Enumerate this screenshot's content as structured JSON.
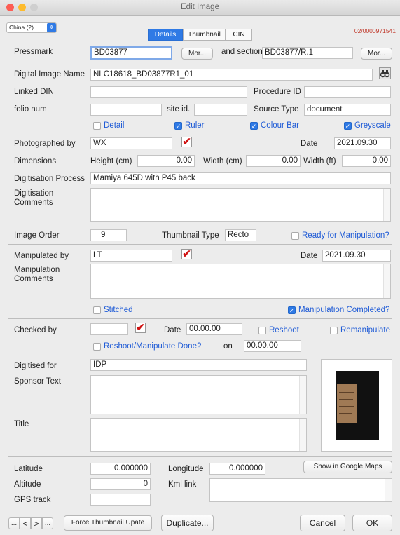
{
  "window": {
    "title": "Edit Image"
  },
  "top": {
    "collection_select": "China (2)",
    "record_id": "02/0000971541",
    "tabs": [
      {
        "label": "Details"
      },
      {
        "label": "Thumbnail"
      },
      {
        "label": "CIN"
      }
    ]
  },
  "fields": {
    "pressmark": {
      "label": "Pressmark",
      "value": "BD03877",
      "more_label": "Mor..."
    },
    "section": {
      "label": "and section",
      "value": "BD03877/R.1",
      "more_label": "Mor..."
    },
    "digital_image_name": {
      "label": "Digital Image Name",
      "value": "NLC18618_BD03877R1_01"
    },
    "linked_din": {
      "label": "Linked DIN",
      "value": ""
    },
    "procedure_id": {
      "label": "Procedure ID",
      "value": ""
    },
    "folio_num": {
      "label": "folio num",
      "value": ""
    },
    "site_id": {
      "label": "site id.",
      "value": ""
    },
    "source_type": {
      "label": "Source Type",
      "value": "document"
    },
    "checkboxes_row": {
      "detail": "Detail",
      "ruler": "Ruler",
      "colour_bar": "Colour Bar",
      "greyscale": "Greyscale"
    },
    "photographed_by": {
      "label": "Photographed by",
      "value": "WX"
    },
    "photo_date": {
      "label": "Date",
      "value": "2021.09.30"
    },
    "dimensions": {
      "label": "Dimensions",
      "height_label": "Height (cm)",
      "height": "0.00",
      "width_label": "Width (cm)",
      "width": "0.00",
      "width_ft_label": "Width (ft)",
      "width_ft": "0.00"
    },
    "digitisation_process": {
      "label": "Digitisation Process",
      "value": "Mamiya 645D with P45 back"
    },
    "digitisation_comments": {
      "label": "Digitisation Comments"
    },
    "image_order": {
      "label": "Image Order",
      "value": "9"
    },
    "thumbnail_type": {
      "label": "Thumbnail Type",
      "value": "Recto"
    },
    "ready_for_manipulation": "Ready for Manipulation?",
    "manipulated_by": {
      "label": "Manipulated by",
      "value": "LT"
    },
    "manip_date": {
      "label": "Date",
      "value": "2021.09.30"
    },
    "manipulation_comments": {
      "label": "Manipulation Comments"
    },
    "stitched": "Stitched",
    "manipulation_completed": "Manipulation Completed?",
    "checked_by": {
      "label": "Checked by",
      "value": ""
    },
    "checked_date": {
      "label": "Date",
      "value": "00.00.00"
    },
    "reshoot": "Reshoot",
    "remanipulate": "Remanipulate",
    "reshoot_done": "Reshoot/Manipulate Done?",
    "on_label": "on",
    "on_date": "00.00.00",
    "digitised_for": {
      "label": "Digitised for",
      "value": "IDP"
    },
    "sponsor_text": {
      "label": "Sponsor Text"
    },
    "title": {
      "label": "Title"
    },
    "latitude": {
      "label": "Latitude",
      "value": "0.000000"
    },
    "longitude": {
      "label": "Longitude",
      "value": "0.000000"
    },
    "altitude": {
      "label": "Altitude",
      "value": "0"
    },
    "kml_link": {
      "label": "Kml link"
    },
    "gps_track": {
      "label": "GPS track"
    }
  },
  "buttons": {
    "show_maps": "Show in Google Maps",
    "nav_first": "...",
    "nav_prev": "<",
    "nav_next": ">",
    "nav_last": "...",
    "force_thumb": "Force Thumbnail Upate",
    "duplicate": "Duplicate...",
    "cancel": "Cancel",
    "ok": "OK"
  },
  "icons": {
    "lookup": "binoculars-icon",
    "checkmark": "✔"
  },
  "colors": {
    "accent": "#2f7ae5",
    "link": "#1f5bd6",
    "record": "#c0392b",
    "check_red": "#d01212"
  }
}
